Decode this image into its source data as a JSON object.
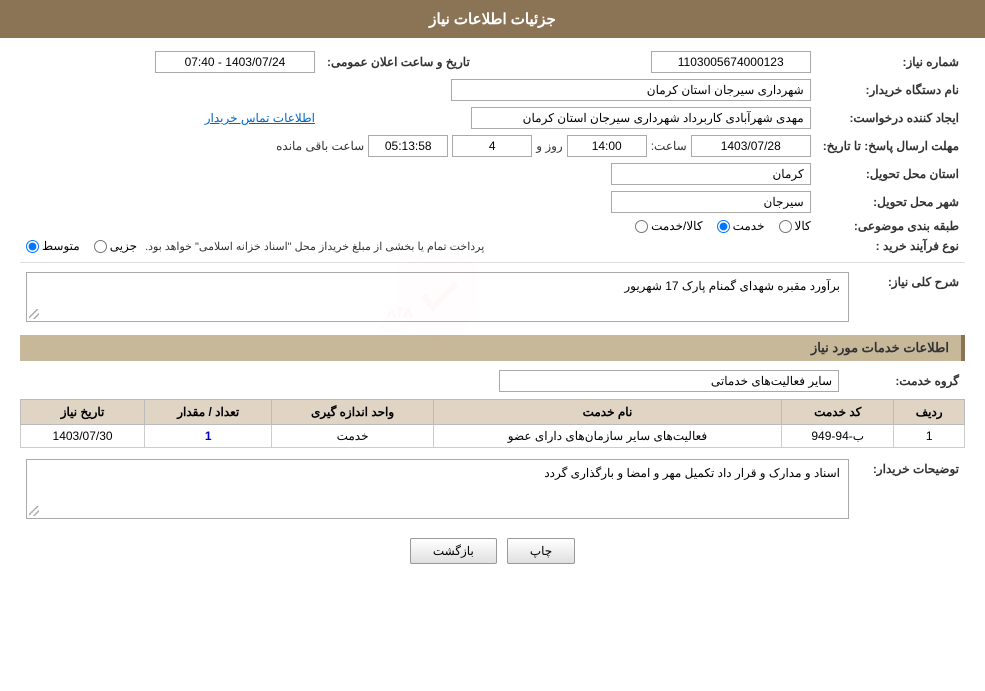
{
  "page": {
    "title": "جزئیات اطلاعات نیاز",
    "sections": {
      "main_info": "جزئیات اطلاعات نیاز",
      "service_info": "اطلاعات خدمات مورد نیاز"
    }
  },
  "header": {
    "title": "جزئیات اطلاعات نیاز"
  },
  "fields": {
    "order_number_label": "شماره نیاز:",
    "order_number_value": "1103005674000123",
    "announcement_date_label": "تاریخ و ساعت اعلان عمومی:",
    "announcement_date_value": "1403/07/24 - 07:40",
    "buyer_org_label": "نام دستگاه خریدار:",
    "buyer_org_value": "شهرداری سیرجان استان کرمان",
    "creator_label": "ایجاد کننده درخواست:",
    "creator_value": "مهدی شهرآبادی کاربرداد شهرداری سیرجان استان کرمان",
    "creator_link": "اطلاعات تماس خریدار",
    "deadline_label": "مهلت ارسال پاسخ: تا تاریخ:",
    "deadline_date": "1403/07/28",
    "deadline_time_label": "ساعت:",
    "deadline_time": "14:00",
    "remaining_days_label": "روز و",
    "remaining_days": "4",
    "remaining_time": "05:13:58",
    "remaining_suffix": "ساعت باقی مانده",
    "province_label": "استان محل تحویل:",
    "province_value": "کرمان",
    "city_label": "شهر محل تحویل:",
    "city_value": "سیرجان",
    "category_label": "طبقه بندی موضوعی:",
    "category_options": [
      "کالا",
      "خدمت",
      "کالا/خدمت"
    ],
    "category_selected": "خدمت",
    "purchase_type_label": "نوع فرآیند خرید :",
    "purchase_options": [
      "جزیی",
      "متوسط"
    ],
    "purchase_notice": "پرداخت تمام یا بخشی از مبلغ خریداز محل \"اسناد خزانه اسلامی\" خواهد بود.",
    "general_desc_label": "شرح کلی نیاز:",
    "general_desc_value": "برآورد مقبره شهدای گمنام پارک 17 شهریور",
    "service_group_label": "گروه خدمت:",
    "service_group_value": "سایر فعالیت‌های خدماتی",
    "table": {
      "headers": [
        "ردیف",
        "کد خدمت",
        "نام خدمت",
        "واحد اندازه گیری",
        "تعداد / مقدار",
        "تاریخ نیاز"
      ],
      "rows": [
        {
          "row_num": "1",
          "service_code": "ب-94-949",
          "service_name": "فعالیت‌های سایر سازمان‌های دارای عضو",
          "unit": "خدمت",
          "quantity": "1",
          "date": "1403/07/30"
        }
      ]
    },
    "buyer_notes_label": "توضیحات خریدار:",
    "buyer_notes_value": "اسناد و مدارک و قرار داد تکمیل مهر و امضا و بارگذاری گردد"
  },
  "buttons": {
    "print_label": "چاپ",
    "back_label": "بازگشت"
  }
}
